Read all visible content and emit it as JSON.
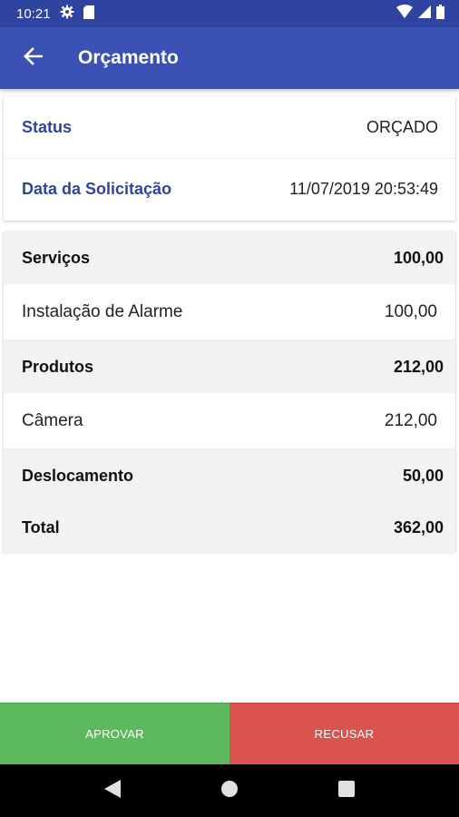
{
  "status_bar": {
    "time": "10:21",
    "icons": [
      "gear-icon",
      "sd-card-icon",
      "wifi-icon",
      "signal-icon",
      "battery-icon"
    ]
  },
  "app_bar": {
    "title": "Orçamento",
    "back_icon": "arrow-left-icon"
  },
  "status_card": {
    "rows": [
      {
        "label": "Status",
        "value": "ORÇADO"
      },
      {
        "label": "Data da Solicitação",
        "value": "11/07/2019 20:53:49"
      }
    ]
  },
  "summary": {
    "services": {
      "label": "Serviços",
      "value": "100,00"
    },
    "service_items": [
      {
        "label": "Instalação de Alarme",
        "value": "100,00"
      }
    ],
    "products": {
      "label": "Produtos",
      "value": "212,00"
    },
    "product_items": [
      {
        "label": "Câmera",
        "value": "212,00"
      }
    ],
    "travel": {
      "label": "Deslocamento",
      "value": "50,00"
    },
    "total": {
      "label": "Total",
      "value": "362,00"
    }
  },
  "actions": {
    "approve_label": "APROVAR",
    "refuse_label": "RECUSAR"
  },
  "colors": {
    "primary": "#3b52b4",
    "primary_dark": "#2f44a0",
    "approve": "#5cb85c",
    "refuse": "#d9534f"
  },
  "nav_bar": {
    "icons": [
      "back-triangle-icon",
      "home-circle-icon",
      "recents-square-icon"
    ]
  }
}
